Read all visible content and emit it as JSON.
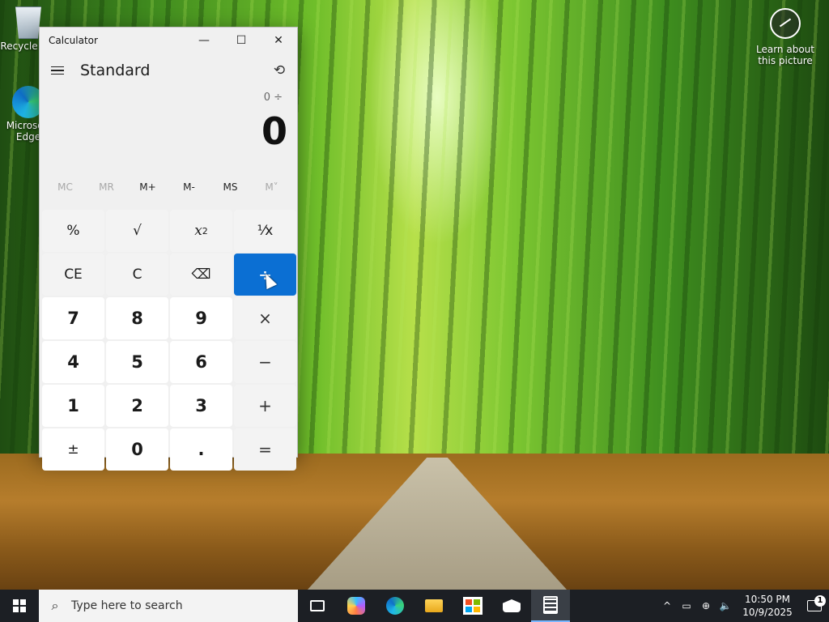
{
  "desktop": {
    "icons": [
      {
        "label": "Recycle Bin",
        "icon": "recycle-bin-icon"
      },
      {
        "label": "Microsoft Edge",
        "icon": "edge-icon"
      }
    ],
    "learn_label": "Learn about this picture"
  },
  "calculator": {
    "window_title": "Calculator",
    "title_buttons": {
      "minimize": "—",
      "maximize": "☐",
      "close": "✕"
    },
    "mode": "Standard",
    "expression": "0 ÷",
    "display": "0",
    "memory": [
      {
        "label": "MC",
        "enabled": false
      },
      {
        "label": "MR",
        "enabled": false
      },
      {
        "label": "M+",
        "enabled": true
      },
      {
        "label": "M-",
        "enabled": true
      },
      {
        "label": "MS",
        "enabled": true
      },
      {
        "label": "M˅",
        "enabled": false
      }
    ],
    "keys": {
      "percent": "%",
      "sqrt": "√",
      "square_base": "x",
      "square_exp": "2",
      "reciprocal": "¹⁄x",
      "ce": "CE",
      "c": "C",
      "backspace": "⌫",
      "divide": "÷",
      "seven": "7",
      "eight": "8",
      "nine": "9",
      "multiply": "×",
      "four": "4",
      "five": "5",
      "six": "6",
      "minus": "−",
      "one": "1",
      "two": "2",
      "three": "3",
      "plus": "+",
      "negate": "±",
      "zero": "0",
      "decimal": ".",
      "equals": "="
    },
    "accent_color": "#0b6fd3"
  },
  "taskbar": {
    "search_placeholder": "Type here to search",
    "clock_time": "10:50 PM",
    "clock_date": "10/9/2025",
    "notification_count": "1",
    "tray_symbols": {
      "chevron": "^",
      "meet": "▭",
      "network": "⊕",
      "volume": "🔈"
    }
  }
}
